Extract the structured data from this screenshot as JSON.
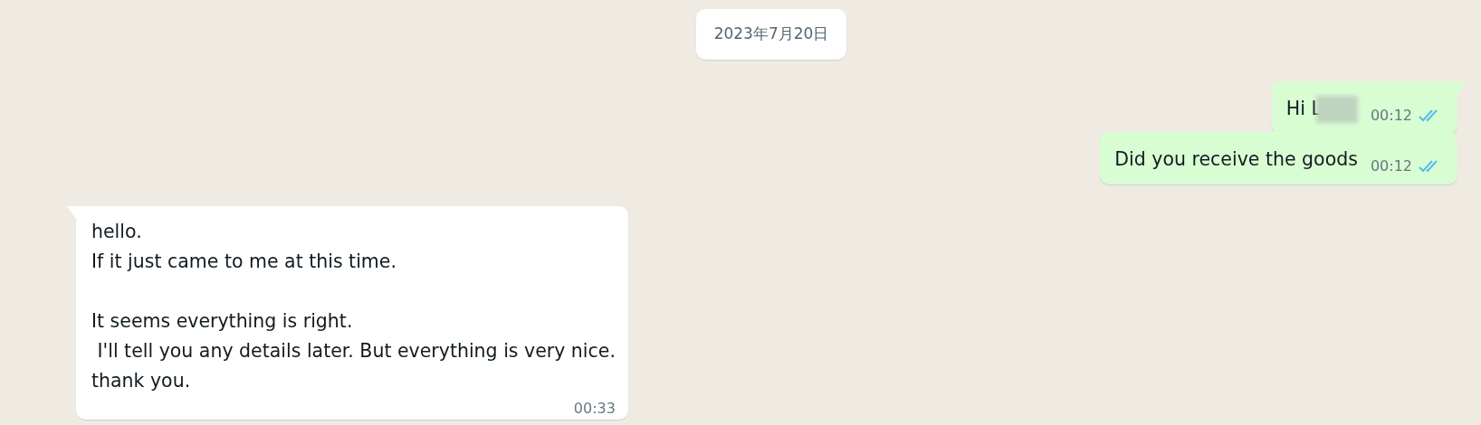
{
  "date_divider": "2023年7月20日",
  "messages": [
    {
      "kind": "sent",
      "tail": true,
      "text": "Hi L",
      "redacted": true,
      "time": "00:12",
      "read": true
    },
    {
      "kind": "sent",
      "tail": false,
      "text": "Did you receive the goods",
      "time": "00:12",
      "read": true
    },
    {
      "kind": "received",
      "tail": true,
      "text": "hello.\nIf it just came to me at this time.\n\nIt seems everything is right.\n I'll tell you any details later. But everything is very nice.\nthank you.",
      "time": "00:33"
    }
  ]
}
